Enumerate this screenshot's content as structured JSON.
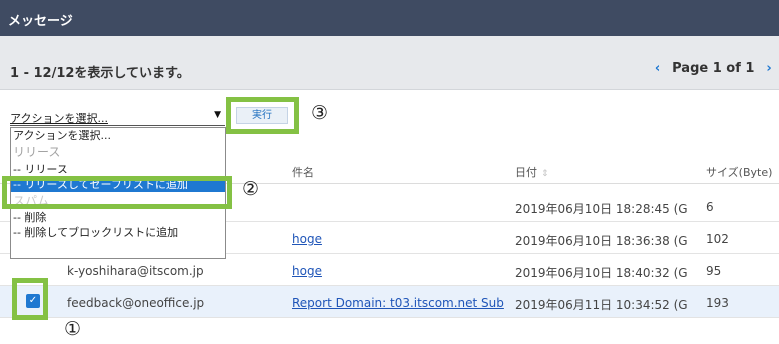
{
  "header": {
    "title": "メッセージ"
  },
  "pager": {
    "count_text": "1 - 12/12を表示しています。",
    "page_text": "Page 1 of 1",
    "prev_glyph": "‹",
    "next_glyph": "›"
  },
  "action": {
    "selected": "アクションを選択...",
    "execute_label": "実行",
    "options": [
      "アクションを選択...",
      "リリース",
      "-- リリース",
      "-- リリースしてセーフリストに追加",
      "スパム",
      "-- 削除",
      "-- 削除してブロックリストに追加"
    ]
  },
  "callouts": {
    "one": "①",
    "two": "②",
    "three": "③"
  },
  "table": {
    "headers": {
      "subject": "件名",
      "date": "日付",
      "size": "サイズ(Byte)"
    },
    "rows": [
      {
        "from": "",
        "subject": "",
        "date": "2019年06月10日 18:28:45 (G",
        "size": "6"
      },
      {
        "from": "",
        "subject": "hoge",
        "date": "2019年06月10日 18:36:38 (G",
        "size": "102"
      },
      {
        "from": "k-yoshihara@itscom.jp",
        "subject": "hoge",
        "date": "2019年06月10日 18:40:32 (G",
        "size": "95"
      },
      {
        "from": "feedback@oneoffice.jp",
        "subject": "Report Domain: t03.itscom.net Sub",
        "date": "2019年06月11日 10:34:52 (G",
        "size": "193",
        "checked": true
      }
    ]
  },
  "colors": {
    "highlight": "#84c144",
    "accent": "#1f78d1",
    "titlebar": "#3f4b62"
  }
}
